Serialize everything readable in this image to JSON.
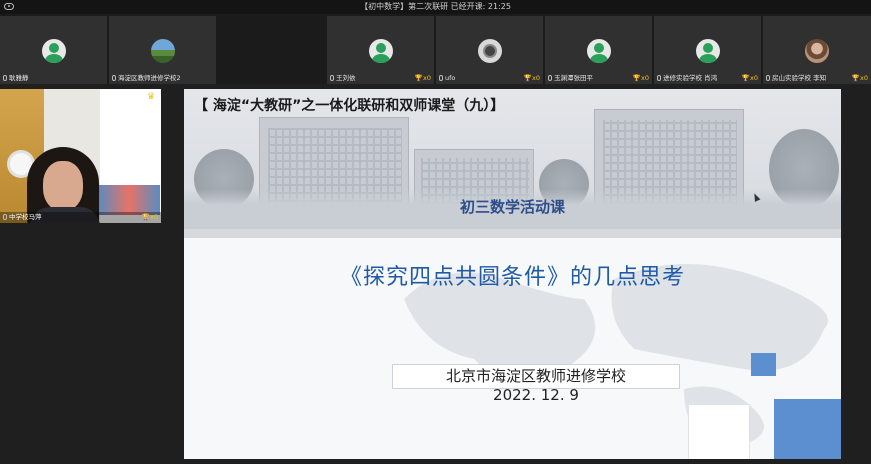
{
  "window": {
    "meeting_title": "【初中数学】第二次联研    已经开课: 21:25"
  },
  "participants": [
    {
      "name": "耿雅静",
      "avatar": "generic",
      "trophy": ""
    },
    {
      "name": "海淀区教师进修学校2",
      "avatar": "landscape",
      "trophy": ""
    },
    {
      "name": "王刘依",
      "avatar": "generic",
      "trophy": "x0"
    },
    {
      "name": "ufo",
      "avatar": "camera",
      "trophy": "x0"
    },
    {
      "name": "玉渊潭张田平",
      "avatar": "generic",
      "trophy": "x0"
    },
    {
      "name": "进修实验学校 肖鸿",
      "avatar": "generic",
      "trophy": "x0"
    },
    {
      "name": "房山实验学校 李知",
      "avatar": "photo",
      "trophy": "x0"
    }
  ],
  "speaker": {
    "name": "中学校马萍",
    "trophy": "x0"
  },
  "slide": {
    "header_title": "【 海淀“大教研”之一体化联研和双师课堂（九）】",
    "activity_title": "初三数学活动课",
    "main_title": "《探究四点共圆条件》的几点思考",
    "org_name": "北京市海淀区教师进修学校",
    "date": "2022. 12. 9"
  },
  "colors": {
    "background": "#1f1f1f",
    "tile": "#303030",
    "trophy": "#f2c21b",
    "title_blue": "#1f5aa8",
    "accent_blue": "#5c8fcf"
  }
}
